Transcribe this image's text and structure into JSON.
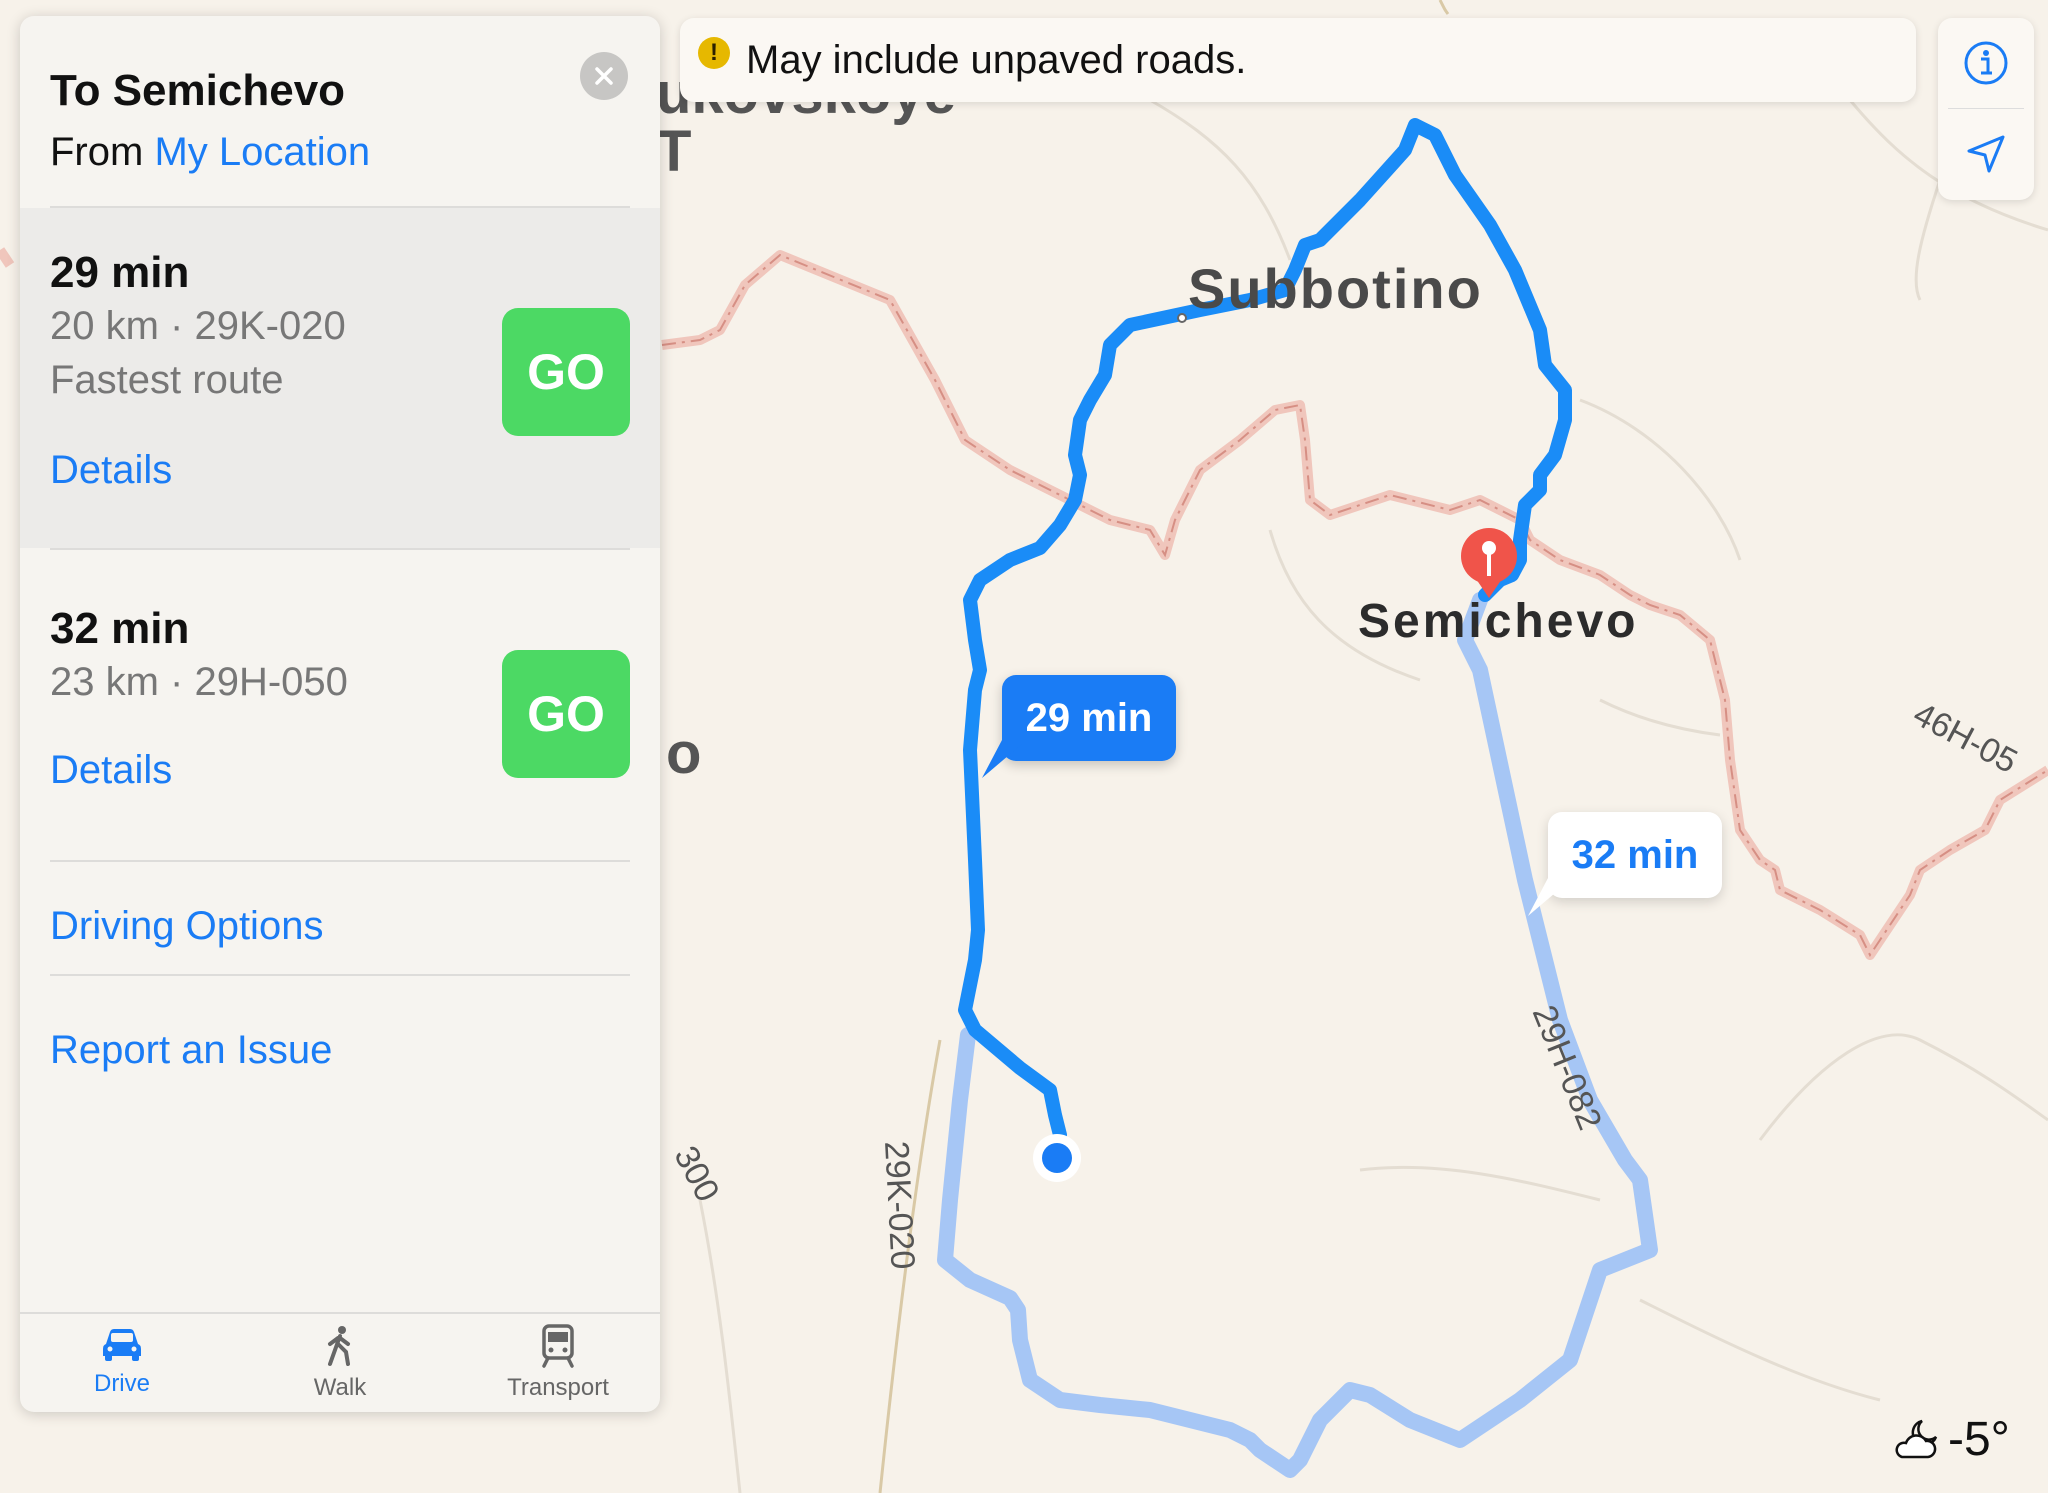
{
  "map": {
    "places": {
      "subbotino": "Subbotino",
      "semichevo": "Semichevo",
      "partial_top": "ukovskoye",
      "partial_top2": "T",
      "partial_mid": "o"
    },
    "roads": {
      "road_a": "29K-020",
      "road_b": "29H-082",
      "road_c": "46H-05",
      "road_d": "300"
    },
    "bubbles": {
      "primary": "29 min",
      "secondary": "32 min"
    },
    "colors": {
      "route_primary": "#1a8cf7",
      "route_secondary": "#a6c6f5",
      "border_line": "#e8a8a0",
      "land": "#f7f2ea"
    }
  },
  "banner": {
    "icon": "warning-icon",
    "text": "May include unpaved roads."
  },
  "controls": {
    "info_icon": "info-icon",
    "location_icon": "location-arrow-icon"
  },
  "weather": {
    "icon": "partly-cloudy-night-icon",
    "temp": "-5°"
  },
  "panel": {
    "title": "To Semichevo",
    "from_prefix": "From",
    "from_link": "My Location",
    "routes": [
      {
        "time": "29 min",
        "distance_road": "20 km · 29K-020",
        "note": "Fastest route",
        "go": "GO",
        "details": "Details"
      },
      {
        "time": "32 min",
        "distance_road": "23 km · 29H-050",
        "go": "GO",
        "details": "Details"
      }
    ],
    "driving_options": "Driving Options",
    "report_issue": "Report an Issue",
    "tabs": [
      {
        "label": "Drive",
        "icon": "car-icon",
        "active": true
      },
      {
        "label": "Walk",
        "icon": "walk-icon",
        "active": false
      },
      {
        "label": "Transport",
        "icon": "train-icon",
        "active": false
      }
    ]
  }
}
